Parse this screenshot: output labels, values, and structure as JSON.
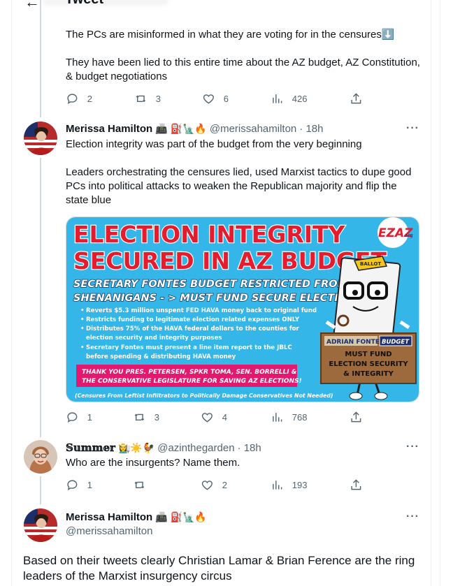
{
  "header": {
    "title": "Tweet",
    "back_icon": "arrow-left-icon"
  },
  "tweet1": {
    "paragraphs": [
      "The PCs are misinformed in what they are voting for in the censures⬇️",
      "They have been lied to this entire time about the AZ budget, AZ Constitution, & budget negotiations"
    ],
    "actions": {
      "replies": "2",
      "retweets": "3",
      "likes": "6",
      "views": "426"
    }
  },
  "tweet2": {
    "name": "Merissa Hamilton",
    "name_emojis": "📠 ⛽🗽🔥",
    "handle": "@merissahamilton",
    "time": "· 18h",
    "paragraphs": [
      "Election integrity was part of the budget from the very beginning",
      "Leaders orchestrating the censures lied, used Marxist tactics to dupe good PCs into political attacks to weaken the Republican majority and flip the state blue"
    ],
    "image": {
      "title1": "ELECTION INTEGRITY",
      "title2": "SECURED IN AZ BUDGET",
      "subtitle1": "SECRETARY FONTES BUDGET RESTRICTED FROM",
      "subtitle2": "SHENANIGANS - > MUST FUND SECURE ELECTIONS",
      "bullets": [
        "Reverts $5.3 million unspent FED HAVA money back to original fund",
        "Restricts funding to legitimate election related expenses ONLY",
        "Distributes 75% of the HAVA federal dollars to the counties for",
        "election security and integrity purposes",
        "Secretary Fontes must present a line item report to the JBLC",
        "before spending & distributing HAVA money"
      ],
      "thanks1": "THANK YOU PRES. PETERSEN, SPKR TOMA, SEN. BORRELLI &",
      "thanks2": "THE CONSERVATIVE LEGISLATURE FOR SAVING AZ ELECTIONS!",
      "footnote": "(Censures From Leftist Infiltrators to Politically Damage Conservatives Not Needed)",
      "ballot": "BALLOT",
      "badge": "EZAZ",
      "badge_sub": ".org",
      "sign_name": "ADRIAN FONTES",
      "sign_budget": "BUDGET",
      "sign1": "MUST FUND",
      "sign2": "ELECTION SECURITY",
      "sign3": "& INTEGRITY"
    },
    "actions": {
      "replies": "1",
      "retweets": "3",
      "likes": "4",
      "views": "768"
    }
  },
  "tweet3": {
    "name": "𝕊𝕦𝕞𝕞𝕖𝕣",
    "name_emojis": "👩‍🌾☀️🐓",
    "handle": "@azinthegarden",
    "time": "· 18h",
    "text": "Who are the insurgents? Name them.",
    "actions": {
      "replies": "1",
      "retweets": "",
      "likes": "2",
      "views": "193"
    }
  },
  "tweet4": {
    "name": "Merissa Hamilton",
    "name_emojis": "📠 ⛽🗽🔥",
    "handle": "@merissahamilton",
    "text": "Based on their tweets clearly Christian Lamar & Brian Ference are the ring leaders of the Marxist insurgency circus"
  },
  "colors": {
    "accent": "#1d9bf0",
    "secondary_text": "#536471",
    "border": "#eff3f4"
  }
}
